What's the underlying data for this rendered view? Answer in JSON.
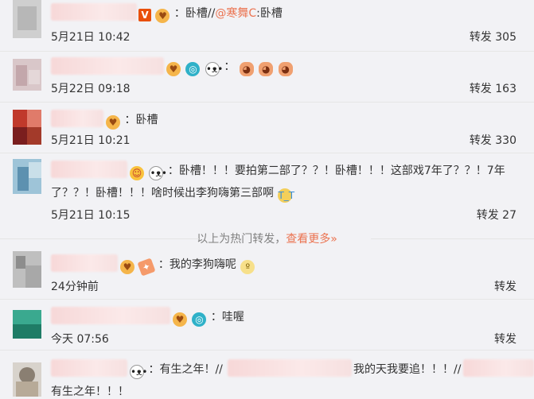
{
  "comments": [
    {
      "text": "：卧槽//",
      "mention": "@寒舞C",
      "mention_after": ":卧槽",
      "time": "5月21日 10:42",
      "forward_label": "转发",
      "forward_count": "305"
    },
    {
      "text": "",
      "time": "5月22日 09:18",
      "forward_label": "转发",
      "forward_count": "163"
    },
    {
      "text": "：卧槽",
      "time": "5月21日 10:21",
      "forward_label": "转发",
      "forward_count": "330"
    },
    {
      "text": "：卧槽！！！要拍第二部了？？！卧槽！！！这部戏7年了？？！7年",
      "text2": "了？？！卧槽！！！啥时候出李狗嗨第三部啊",
      "time": "5月21日 10:15",
      "forward_label": "转发",
      "forward_count": "27"
    },
    {
      "text": "：我的李狗嗨呢",
      "time": "24分钟前",
      "forward_label": "转发"
    },
    {
      "text": "：哇喔",
      "time": "今天 07:56",
      "forward_label": "转发"
    },
    {
      "text": "：有生之年！//",
      "text_mid": "我的天我要追！！！//",
      "text2": "有生之年！！！"
    }
  ],
  "hot_notice": {
    "text": "以上为热门转发，",
    "link": "查看更多»"
  },
  "icons": [
    "v-badge-icon",
    "hug-emoji-icon",
    "camera-emoji-icon",
    "panda-emoji-icon",
    "fish-emoji-icon",
    "smile-emoji-icon",
    "crying-emoji-icon",
    "cheer-emoji-icon",
    "blush-emoji-icon"
  ]
}
